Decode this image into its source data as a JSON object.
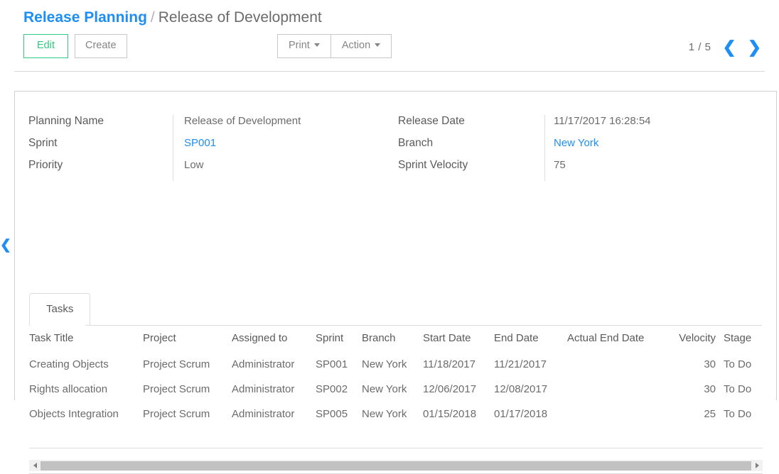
{
  "header": {
    "breadcrumb": {
      "parent": "Release Planning",
      "separator": "/",
      "current": "Release of Development"
    },
    "buttons": {
      "edit": "Edit",
      "create": "Create",
      "print": "Print",
      "action": "Action"
    },
    "pager": {
      "count": "1 / 5",
      "prev_icon": "chevron-left-icon",
      "next_icon": "chevron-right-icon"
    }
  },
  "edge_handle": {
    "icon": "chevron-left-icon"
  },
  "form": {
    "left_column": [
      {
        "label": "Planning Name",
        "value": "Release of Development",
        "is_link": false
      },
      {
        "label": "Sprint",
        "value": "SP001",
        "is_link": true
      },
      {
        "label": "Priority",
        "value": "Low",
        "is_link": false
      }
    ],
    "right_column": [
      {
        "label": "Release Date",
        "value": "11/17/2017 16:28:54",
        "is_link": false
      },
      {
        "label": "Branch",
        "value": "New York",
        "is_link": true
      },
      {
        "label": "Sprint Velocity",
        "value": "75",
        "is_link": false
      }
    ]
  },
  "tabs": [
    {
      "label": "Tasks",
      "active": true
    }
  ],
  "table": {
    "columns": [
      "Task Title",
      "Project",
      "Assigned to",
      "Sprint",
      "Branch",
      "Start Date",
      "End Date",
      "Actual End Date",
      "Velocity",
      "Stage"
    ],
    "rows": [
      {
        "task_title": "Creating Objects",
        "project": "Project Scrum",
        "assigned_to": "Administrator",
        "sprint": "SP001",
        "branch": "New York",
        "start_date": "11/18/2017",
        "end_date": "11/21/2017",
        "actual_end_date": "",
        "velocity": "30",
        "stage": "To Do"
      },
      {
        "task_title": "Rights allocation",
        "project": "Project Scrum",
        "assigned_to": "Administrator",
        "sprint": "SP002",
        "branch": "New York",
        "start_date": "12/06/2017",
        "end_date": "12/08/2017",
        "actual_end_date": "",
        "velocity": "30",
        "stage": "To Do"
      },
      {
        "task_title": "Objects Integration",
        "project": "Project Scrum",
        "assigned_to": "Administrator",
        "sprint": "SP005",
        "branch": "New York",
        "start_date": "01/15/2018",
        "end_date": "01/17/2018",
        "actual_end_date": "",
        "velocity": "25",
        "stage": "To Do"
      }
    ]
  },
  "scrollbar": {
    "left_arrow_icon": "triangle-left-icon",
    "right_arrow_icon": "triangle-right-icon"
  },
  "colors": {
    "link": "#1e8ef5",
    "edit_accent": "#2ecc82",
    "text": "#6b6b6b",
    "border": "#d0d0d0"
  }
}
